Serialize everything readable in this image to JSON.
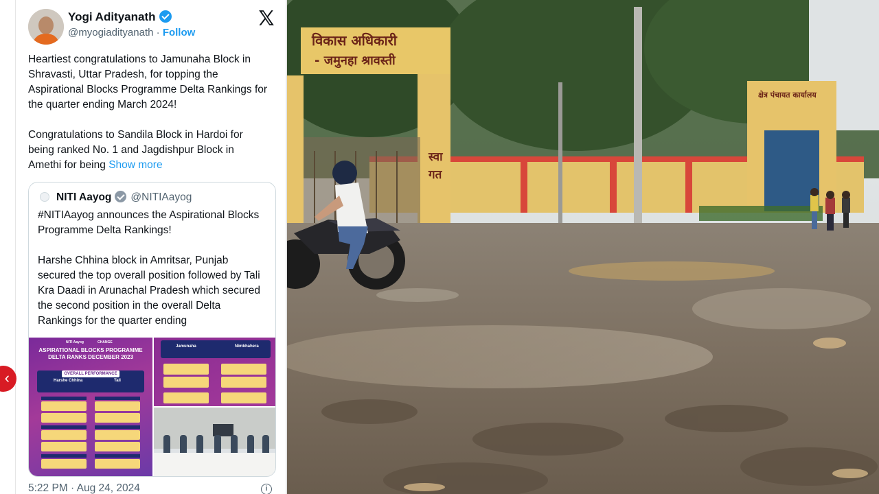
{
  "tweet": {
    "author_name": "Yogi Adityanath",
    "handle": "@myogiadityanath",
    "separator": "·",
    "follow_label": "Follow",
    "text": "Heartiest congratulations to Jamunaha Block in Shravasti, Uttar Pradesh, for topping the Aspirational Blocks Programme Delta Rankings for the quarter ending March 2024!\n\nCongratulations to Sandila Block in Hardoi for being ranked No. 1 and Jagdishpur Block in Amethi for being ",
    "show_more_label": "Show more",
    "timestamp": "5:22 PM · Aug 24, 2024",
    "quote": {
      "author_name": "NITI Aayog",
      "handle": "@NITIAayog",
      "text": "#NITIAayog announces the Aspirational Blocks Programme Delta Rankings!\n\nHarshe Chhina block in Amritsar, Punjab secured the top overall position followed by Tali Kra Daadi in Arunachal Pradesh which secured the second position in the overall Delta Rankings for the quarter ending"
    },
    "media": {
      "poster_org": "NITI Aayog",
      "poster_tag": "CHANGE",
      "poster_title": "ASPIRATIONAL BLOCKS PROGRAMME\nDELTA RANKS DECEMBER 2023",
      "poster_section": "OVERALL PERFORMANCE",
      "poster_first": "Harshe Chhina",
      "poster_second": "Tali",
      "poster2_first": "Jamunaha",
      "poster2_second": "Nimbhahera"
    }
  },
  "photo": {
    "gate_sign_top": "विकास अधिकारी",
    "gate_sign_bottom": "- जमुनहा श्रावस्ती",
    "wall_text": "स्वा\nगत",
    "right_gate_sign": "क्षेत्र पंचायत कार्यालय"
  },
  "icons": {
    "verified": "verified-badge-icon",
    "x_logo": "x-logo-icon",
    "info": "info-icon",
    "nav": "chevron-left-icon"
  },
  "colors": {
    "link": "#1d9bf0",
    "verified": "#1d9bf0",
    "nav_arrow": "#d81b24"
  }
}
